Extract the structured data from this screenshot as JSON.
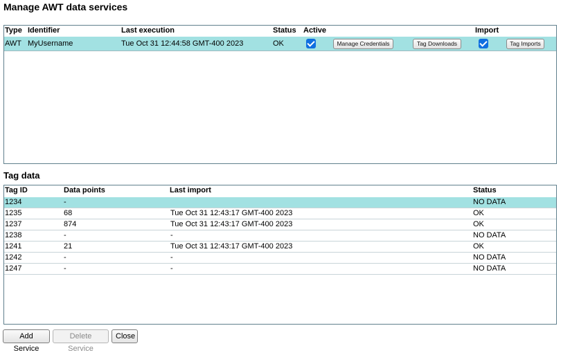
{
  "title": "Manage AWT data services",
  "services": {
    "columns": [
      "Type",
      "Identifier",
      "Last execution",
      "Status",
      "Active",
      "Import"
    ],
    "rows": [
      {
        "type": "AWT",
        "identifier": "MyUsername",
        "last_execution": "Tue Oct 31 12:44:58 GMT-400 2023",
        "status": "OK",
        "active": true,
        "import": true,
        "manage_credentials_label": "Manage Credentials",
        "tag_downloads_label": "Tag Downloads",
        "tag_imports_label": "Tag Imports"
      }
    ]
  },
  "tag_data": {
    "title": "Tag data",
    "columns": [
      "Tag ID",
      "Data points",
      "Last import",
      "Status"
    ],
    "rows": [
      {
        "tag_id": "1234",
        "data_points": "-",
        "last_import": "",
        "status": "NO DATA"
      },
      {
        "tag_id": "1235",
        "data_points": "68",
        "last_import": "Tue Oct 31 12:43:17 GMT-400 2023",
        "status": "OK"
      },
      {
        "tag_id": "1237",
        "data_points": "874",
        "last_import": "Tue Oct 31 12:43:17 GMT-400 2023",
        "status": "OK"
      },
      {
        "tag_id": "1238",
        "data_points": "-",
        "last_import": "-",
        "status": "NO DATA"
      },
      {
        "tag_id": "1241",
        "data_points": "21",
        "last_import": "Tue Oct 31 12:43:17 GMT-400 2023",
        "status": "OK"
      },
      {
        "tag_id": "1242",
        "data_points": "-",
        "last_import": "-",
        "status": "NO DATA"
      },
      {
        "tag_id": "1247",
        "data_points": "-",
        "last_import": "-",
        "status": "NO DATA"
      }
    ]
  },
  "buttons": {
    "add_service": "Add Service",
    "delete_service": "Delete Service",
    "close": "Close"
  },
  "colors": {
    "selected_row": "#a2e1e2",
    "checkbox": "#0f6fe0",
    "panel_border": "#5f7f8c"
  }
}
